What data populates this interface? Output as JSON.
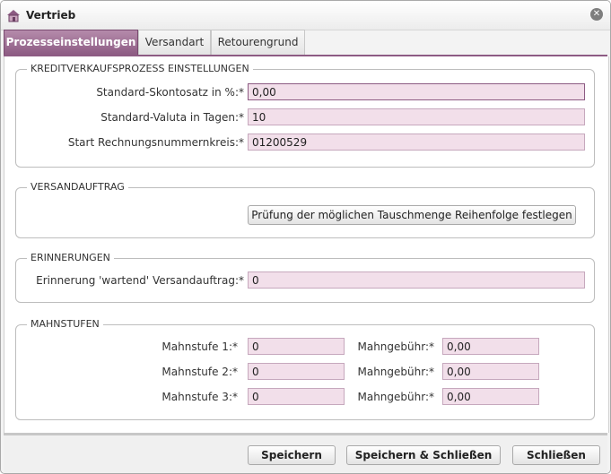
{
  "window": {
    "title": "Vertrieb"
  },
  "tabs": [
    {
      "label": "Prozesseinstellungen"
    },
    {
      "label": "Versandart"
    },
    {
      "label": "Retourengrund"
    }
  ],
  "kredit": {
    "legend": "KREDITVERKAUFSPROZESS EINSTELLUNGEN",
    "skonto_label": "Standard-Skontosatz in %:*",
    "skonto_value": "0,00",
    "valuta_label": "Standard-Valuta in Tagen:*",
    "valuta_value": "10",
    "rechnung_label": "Start Rechnungsnummernkreis:*",
    "rechnung_value": "01200529"
  },
  "versand": {
    "legend": "VERSANDAUFTRAG",
    "button_label": "Prüfung der möglichen Tauschmenge Reihenfolge festlegen"
  },
  "erinnerungen": {
    "legend": "ERINNERUNGEN",
    "label": "Erinnerung 'wartend' Versandauftrag:*",
    "value": "0"
  },
  "mahnstufen": {
    "legend": "MAHNSTUFEN",
    "rows": [
      {
        "stufe_label": "Mahnstufe 1:*",
        "stufe_value": "0",
        "gebuehr_label": "Mahngebühr:*",
        "gebuehr_value": "0,00"
      },
      {
        "stufe_label": "Mahnstufe 2:*",
        "stufe_value": "0",
        "gebuehr_label": "Mahngebühr:*",
        "gebuehr_value": "0,00"
      },
      {
        "stufe_label": "Mahnstufe 3:*",
        "stufe_value": "0",
        "gebuehr_label": "Mahngebühr:*",
        "gebuehr_value": "0,00"
      }
    ]
  },
  "footer": {
    "save": "Speichern",
    "save_close": "Speichern & Schließen",
    "close": "Schließen"
  }
}
